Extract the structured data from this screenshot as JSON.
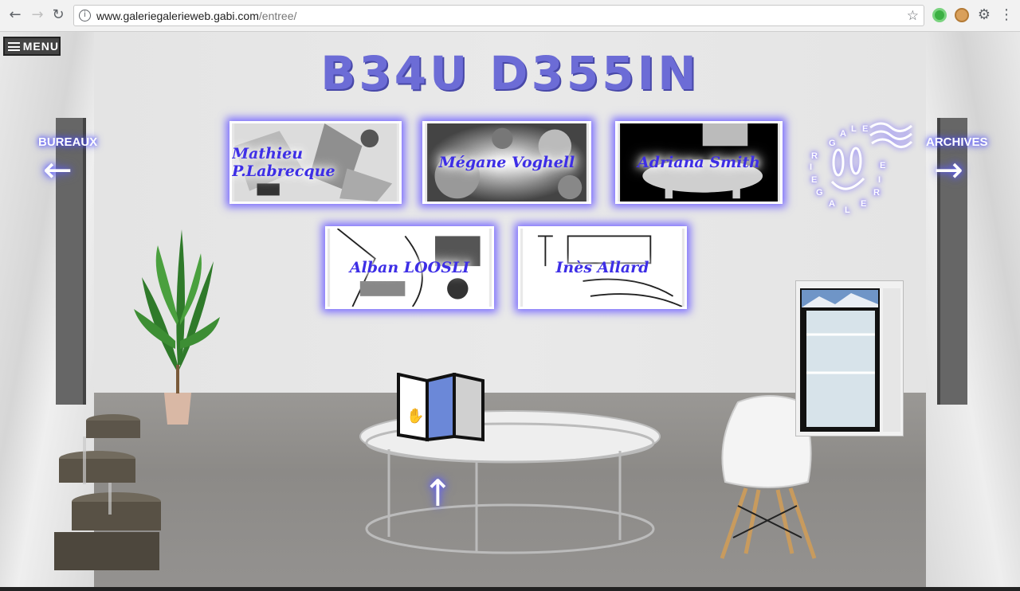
{
  "browser": {
    "back_icon": "←",
    "forward_icon": "→",
    "reload_icon": "↻",
    "url_host": "www.galeriegalerieweb.gabi.com",
    "url_path": "/entree/",
    "info_icon": "i",
    "bookmark_icon": "☆",
    "more_icon": "⋮"
  },
  "page": {
    "menu_label": "MENU",
    "title": "B34U D355IN",
    "nav_left_label": "BUREAUX",
    "nav_right_label": "ARCHIVES",
    "nav_left_arrow": "←",
    "nav_right_arrow": "→",
    "up_arrow": "↑",
    "logo_letters": [
      "G",
      "A",
      "L",
      "E",
      "R",
      "I",
      "E",
      "G",
      "A",
      "L",
      "E",
      "R",
      "I",
      "E"
    ]
  },
  "artists": [
    {
      "name": "Mathieu P.Labrecque"
    },
    {
      "name": "Mégane Voghell"
    },
    {
      "name": "Adriana Smith"
    },
    {
      "name": "Alban LOOSLI"
    },
    {
      "name": "Inès Allard"
    }
  ]
}
